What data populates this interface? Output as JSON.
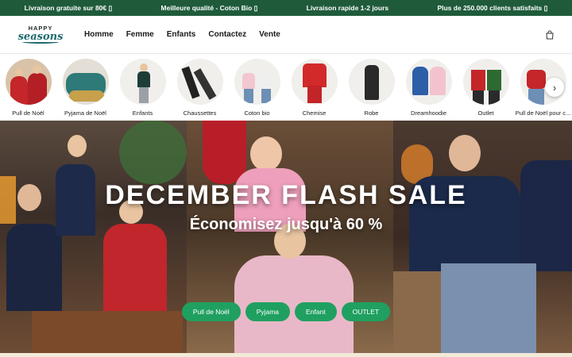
{
  "announcements": [
    "Livraison gratuite sur 80€ ▯",
    "Meilleure qualité - Coton Bio ▯",
    "Livraison rapide 1-2 jours",
    "Plus de 250.000 clients satisfaits ▯"
  ],
  "logo": {
    "line1": "HAPPY",
    "line2": "seasons"
  },
  "nav": [
    "Homme",
    "Femme",
    "Enfants",
    "Contactez",
    "Vente"
  ],
  "categories": [
    "Pull de Noël",
    "Pyjama de Noël",
    "Enfants",
    "Chaussettes",
    "Coton bio",
    "Chemise",
    "Robe",
    "Dreamhoodie",
    "Outlet",
    "Pull de Noël pour c..."
  ],
  "hero": {
    "title": "DECEMBER FLASH SALE",
    "subtitle": "Économisez jusqu'à 60 %",
    "buttons": [
      "Pull de Noël",
      "Pyjama",
      "Enfant",
      "OUTLET"
    ]
  },
  "colors": {
    "announce_bg": "#1f5b3b",
    "button": "#20a060",
    "logo": "#1d6a6e"
  },
  "icons": {
    "cart": "shopping-bag-icon",
    "next": "chevron-right-icon"
  }
}
